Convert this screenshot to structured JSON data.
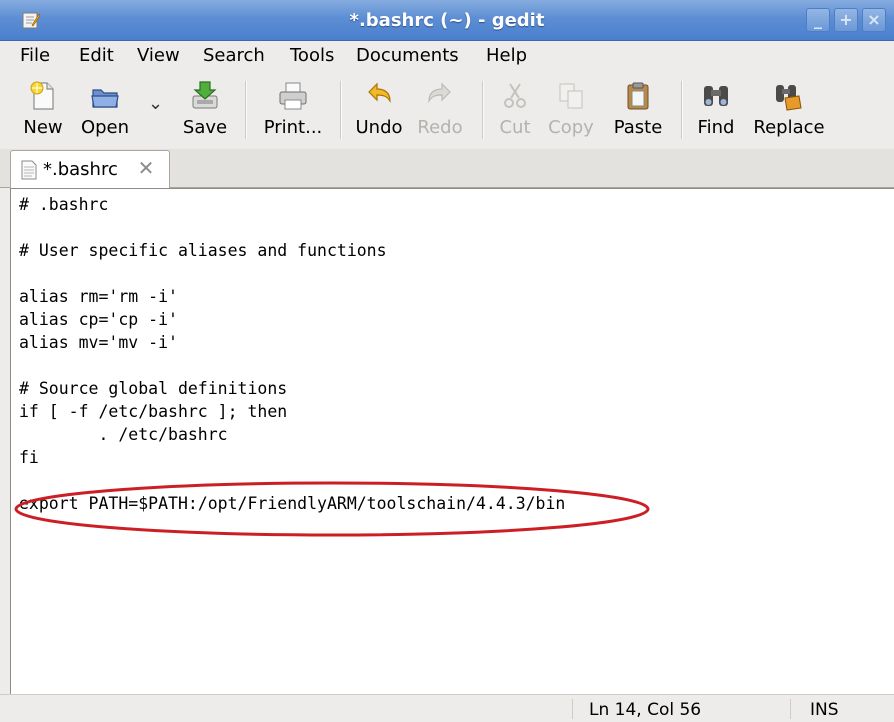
{
  "window": {
    "title": "*.bashrc (~) - gedit",
    "icon": "gedit-app-icon",
    "controls": {
      "minimize_glyph": "_",
      "maximize_glyph": "+",
      "close_glyph": "×"
    }
  },
  "menu": {
    "file": "File",
    "edit": "Edit",
    "view": "View",
    "search": "Search",
    "tools": "Tools",
    "documents": "Documents",
    "help": "Help"
  },
  "toolbar": {
    "new": {
      "label": "New",
      "icon": "new-document-icon",
      "enabled": true
    },
    "open": {
      "label": "Open",
      "icon": "open-folder-icon",
      "enabled": true
    },
    "open_dropdown": {
      "icon": "chevron-down-icon",
      "glyph": "⌄"
    },
    "save": {
      "label": "Save",
      "icon": "save-icon",
      "enabled": true
    },
    "print": {
      "label": "Print...",
      "icon": "printer-icon",
      "enabled": true
    },
    "undo": {
      "label": "Undo",
      "icon": "undo-icon",
      "enabled": true
    },
    "redo": {
      "label": "Redo",
      "icon": "redo-icon",
      "enabled": false
    },
    "cut": {
      "label": "Cut",
      "icon": "scissors-icon",
      "enabled": false
    },
    "copy": {
      "label": "Copy",
      "icon": "copy-icon",
      "enabled": false
    },
    "paste": {
      "label": "Paste",
      "icon": "clipboard-icon",
      "enabled": true
    },
    "find": {
      "label": "Find",
      "icon": "binoculars-icon",
      "enabled": true
    },
    "replace": {
      "label": "Replace",
      "icon": "find-replace-icon",
      "enabled": true
    }
  },
  "tab": {
    "label": "*.bashrc",
    "icon": "text-file-icon",
    "close_glyph": "✕"
  },
  "editor": {
    "lines": [
      "# .bashrc",
      "",
      "# User specific aliases and functions",
      "",
      "alias rm='rm -i'",
      "alias cp='cp -i'",
      "alias mv='mv -i'",
      "",
      "# Source global definitions",
      "if [ -f /etc/bashrc ]; then",
      "        . /etc/bashrc",
      "fi",
      "",
      "export PATH=$PATH:/opt/FriendlyARM/toolschain/4.4.3/bin"
    ],
    "highlighted_line_index": 13,
    "highlight_color": "#cc1f25"
  },
  "status": {
    "position": "Ln 14, Col 56",
    "mode": "INS"
  },
  "colors": {
    "titlebar": "#5d8ed4",
    "chrome": "#edeceb",
    "editor_bg": "#ffffff",
    "annotation": "#cc1f25"
  }
}
